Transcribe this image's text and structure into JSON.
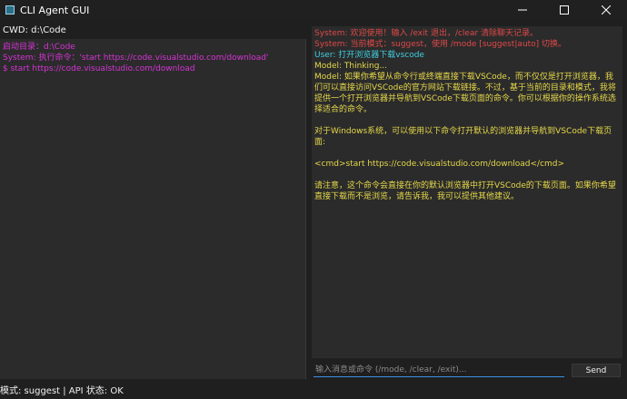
{
  "window": {
    "title": "CLI Agent GUI",
    "icon": "terminal-app-icon",
    "controls": [
      "minimize-icon",
      "maximize-icon",
      "close-icon"
    ]
  },
  "cwd_label": "CWD: d:\\Code",
  "terminal": {
    "lines": [
      {
        "text": "启动目录：d:\\Code",
        "color": "#d633d6"
      },
      {
        "text": "System: 执行命令：'start https://code.visualstudio.com/download'",
        "color": "#d633d6"
      },
      {
        "text": "$ start https://code.visualstudio.com/download",
        "color": "#d633d6"
      }
    ]
  },
  "chat": {
    "lines": [
      {
        "text": "System: 欢迎使用！输入 /exit 退出，/clear 清除聊天记录。",
        "color": "#e04848"
      },
      {
        "text": "System: 当前模式：suggest，使用 /mode [suggest|auto] 切换。",
        "color": "#e04848"
      },
      {
        "text": "User: 打开浏览器下载vscode",
        "color": "#3fd0e0"
      },
      {
        "text": "Model: Thinking...",
        "color": "#e6d84a"
      },
      {
        "text": "Model: 如果你希望从命令行或终端直接下载VSCode，而不仅仅是打开浏览器，我们可以直接访问VSCode的官方网站下载链接。不过，基于当前的目录和模式，我将提供一个打开浏览器并导航到VSCode下载页面的命令。你可以根据你的操作系统选择适合的命令。",
        "color": "#e6d84a"
      },
      {
        "text": "",
        "color": "#e6d84a"
      },
      {
        "text": "对于Windows系统，可以使用以下命令打开默认的浏览器并导航到VSCode下载页面:",
        "color": "#e6d84a"
      },
      {
        "text": "",
        "color": "#e6d84a"
      },
      {
        "text": "<cmd>start https://code.visualstudio.com/download</cmd>",
        "color": "#e6d84a"
      },
      {
        "text": "",
        "color": "#e6d84a"
      },
      {
        "text": "请注意，这个命令会直接在你的默认浏览器中打开VSCode的下载页面。如果你希望直接下载而不是浏览，请告诉我，我可以提供其他建议。",
        "color": "#e6d84a"
      }
    ]
  },
  "input": {
    "placeholder": "输入消息或命令 (/mode, /clear, /exit)...",
    "value": ""
  },
  "send_label": "Send",
  "status": "模式: suggest | API 状态: OK"
}
